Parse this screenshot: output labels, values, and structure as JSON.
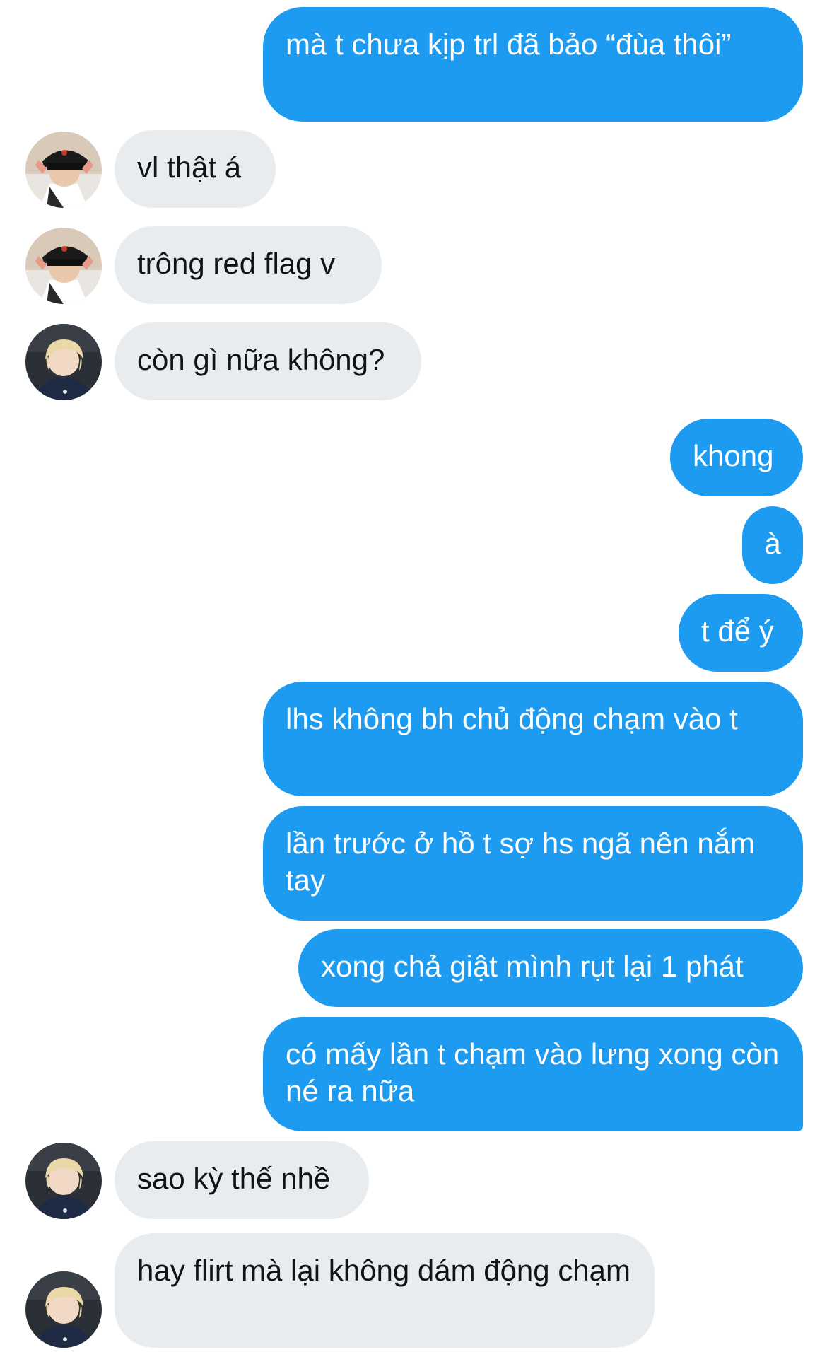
{
  "messages": [
    {
      "from": "me",
      "text": "mà t chưa kịp trl đã bảo “đùa thôi”"
    },
    {
      "from": "friend_a",
      "text": "vl thật á",
      "avatar": "avatar-black-cap"
    },
    {
      "from": "friend_a",
      "text": "trông red flag v",
      "avatar": "avatar-black-cap"
    },
    {
      "from": "friend_b",
      "text": "còn gì nữa không?",
      "avatar": "avatar-blond-hair"
    },
    {
      "from": "me",
      "text": "khong"
    },
    {
      "from": "me",
      "text": "à"
    },
    {
      "from": "me",
      "text": "t để ý"
    },
    {
      "from": "me",
      "text": "lhs không bh chủ động chạm vào t"
    },
    {
      "from": "me",
      "text": "lần trước ở hồ t sợ hs ngã nên nắm tay"
    },
    {
      "from": "me",
      "text": "xong chả giật mình rụt lại 1 phát"
    },
    {
      "from": "me",
      "text": "có mấy lần t chạm vào lưng xong còn né ra nữa"
    },
    {
      "from": "friend_b",
      "text": "sao kỳ thế nhề",
      "avatar": "avatar-blond-hair"
    },
    {
      "from": "friend_b",
      "text": "hay flirt mà lại không dám động chạm",
      "avatar": "avatar-blond-hair"
    }
  ],
  "colors": {
    "outgoing_bubble": "#1d9bf0",
    "incoming_bubble": "#e8ecef",
    "outgoing_text": "#ffffff",
    "incoming_text": "#0f1419"
  }
}
